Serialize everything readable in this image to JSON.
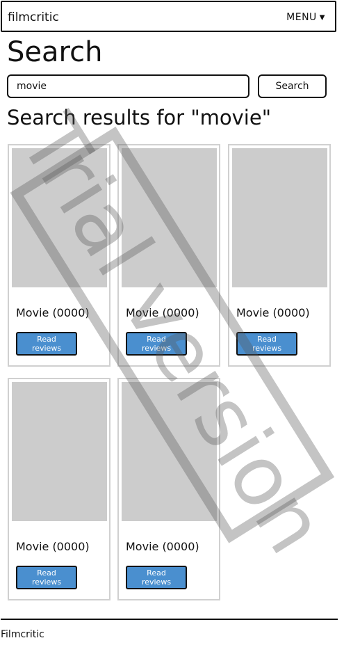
{
  "navbar": {
    "brand": "filmcritic",
    "menu_label": "MENU",
    "menu_caret": "▼"
  },
  "page": {
    "title": "Search"
  },
  "search": {
    "value": "movie",
    "button_label": "Search"
  },
  "results": {
    "heading": "Search results for \"movie\"",
    "items": [
      {
        "title": "Movie (0000)",
        "button_label": "Read reviews"
      },
      {
        "title": "Movie (0000)",
        "button_label": "Read reviews"
      },
      {
        "title": "Movie (0000)",
        "button_label": "Read reviews"
      },
      {
        "title": "Movie (0000)",
        "button_label": "Read reviews"
      },
      {
        "title": "Movie (0000)",
        "button_label": "Read reviews"
      }
    ]
  },
  "footer": {
    "text": "Filmcritic"
  },
  "watermark": {
    "text": "Trial version"
  },
  "colors": {
    "button_blue": "#4a8fcf",
    "placeholder_gray": "#cccccc",
    "card_border": "#d0d0d0"
  }
}
